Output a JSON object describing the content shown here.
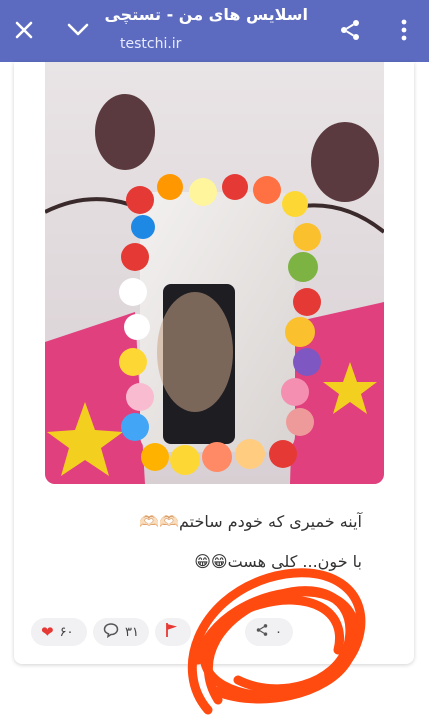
{
  "topbar": {
    "title": "اسلایس های من - تستچی",
    "url": "testchi.ir",
    "close_icon": "close-icon",
    "chevron_icon": "chevron-down-icon",
    "share_icon": "share-icon",
    "menu_icon": "more-vertical-icon"
  },
  "post": {
    "image_description_icon": "image",
    "caption_line1": "آینه خمیری که خودم ساختم🫶🏻🫶🏻",
    "caption_line2": "با خون... کلی هست😁😁"
  },
  "actions": {
    "likes": "۶۰",
    "comments": "۳۱",
    "shares": "۰"
  },
  "colors": {
    "appbar": "#5c6bc0",
    "scribble": "#ff4a10",
    "like": "#e53935",
    "report": "#e53935"
  }
}
